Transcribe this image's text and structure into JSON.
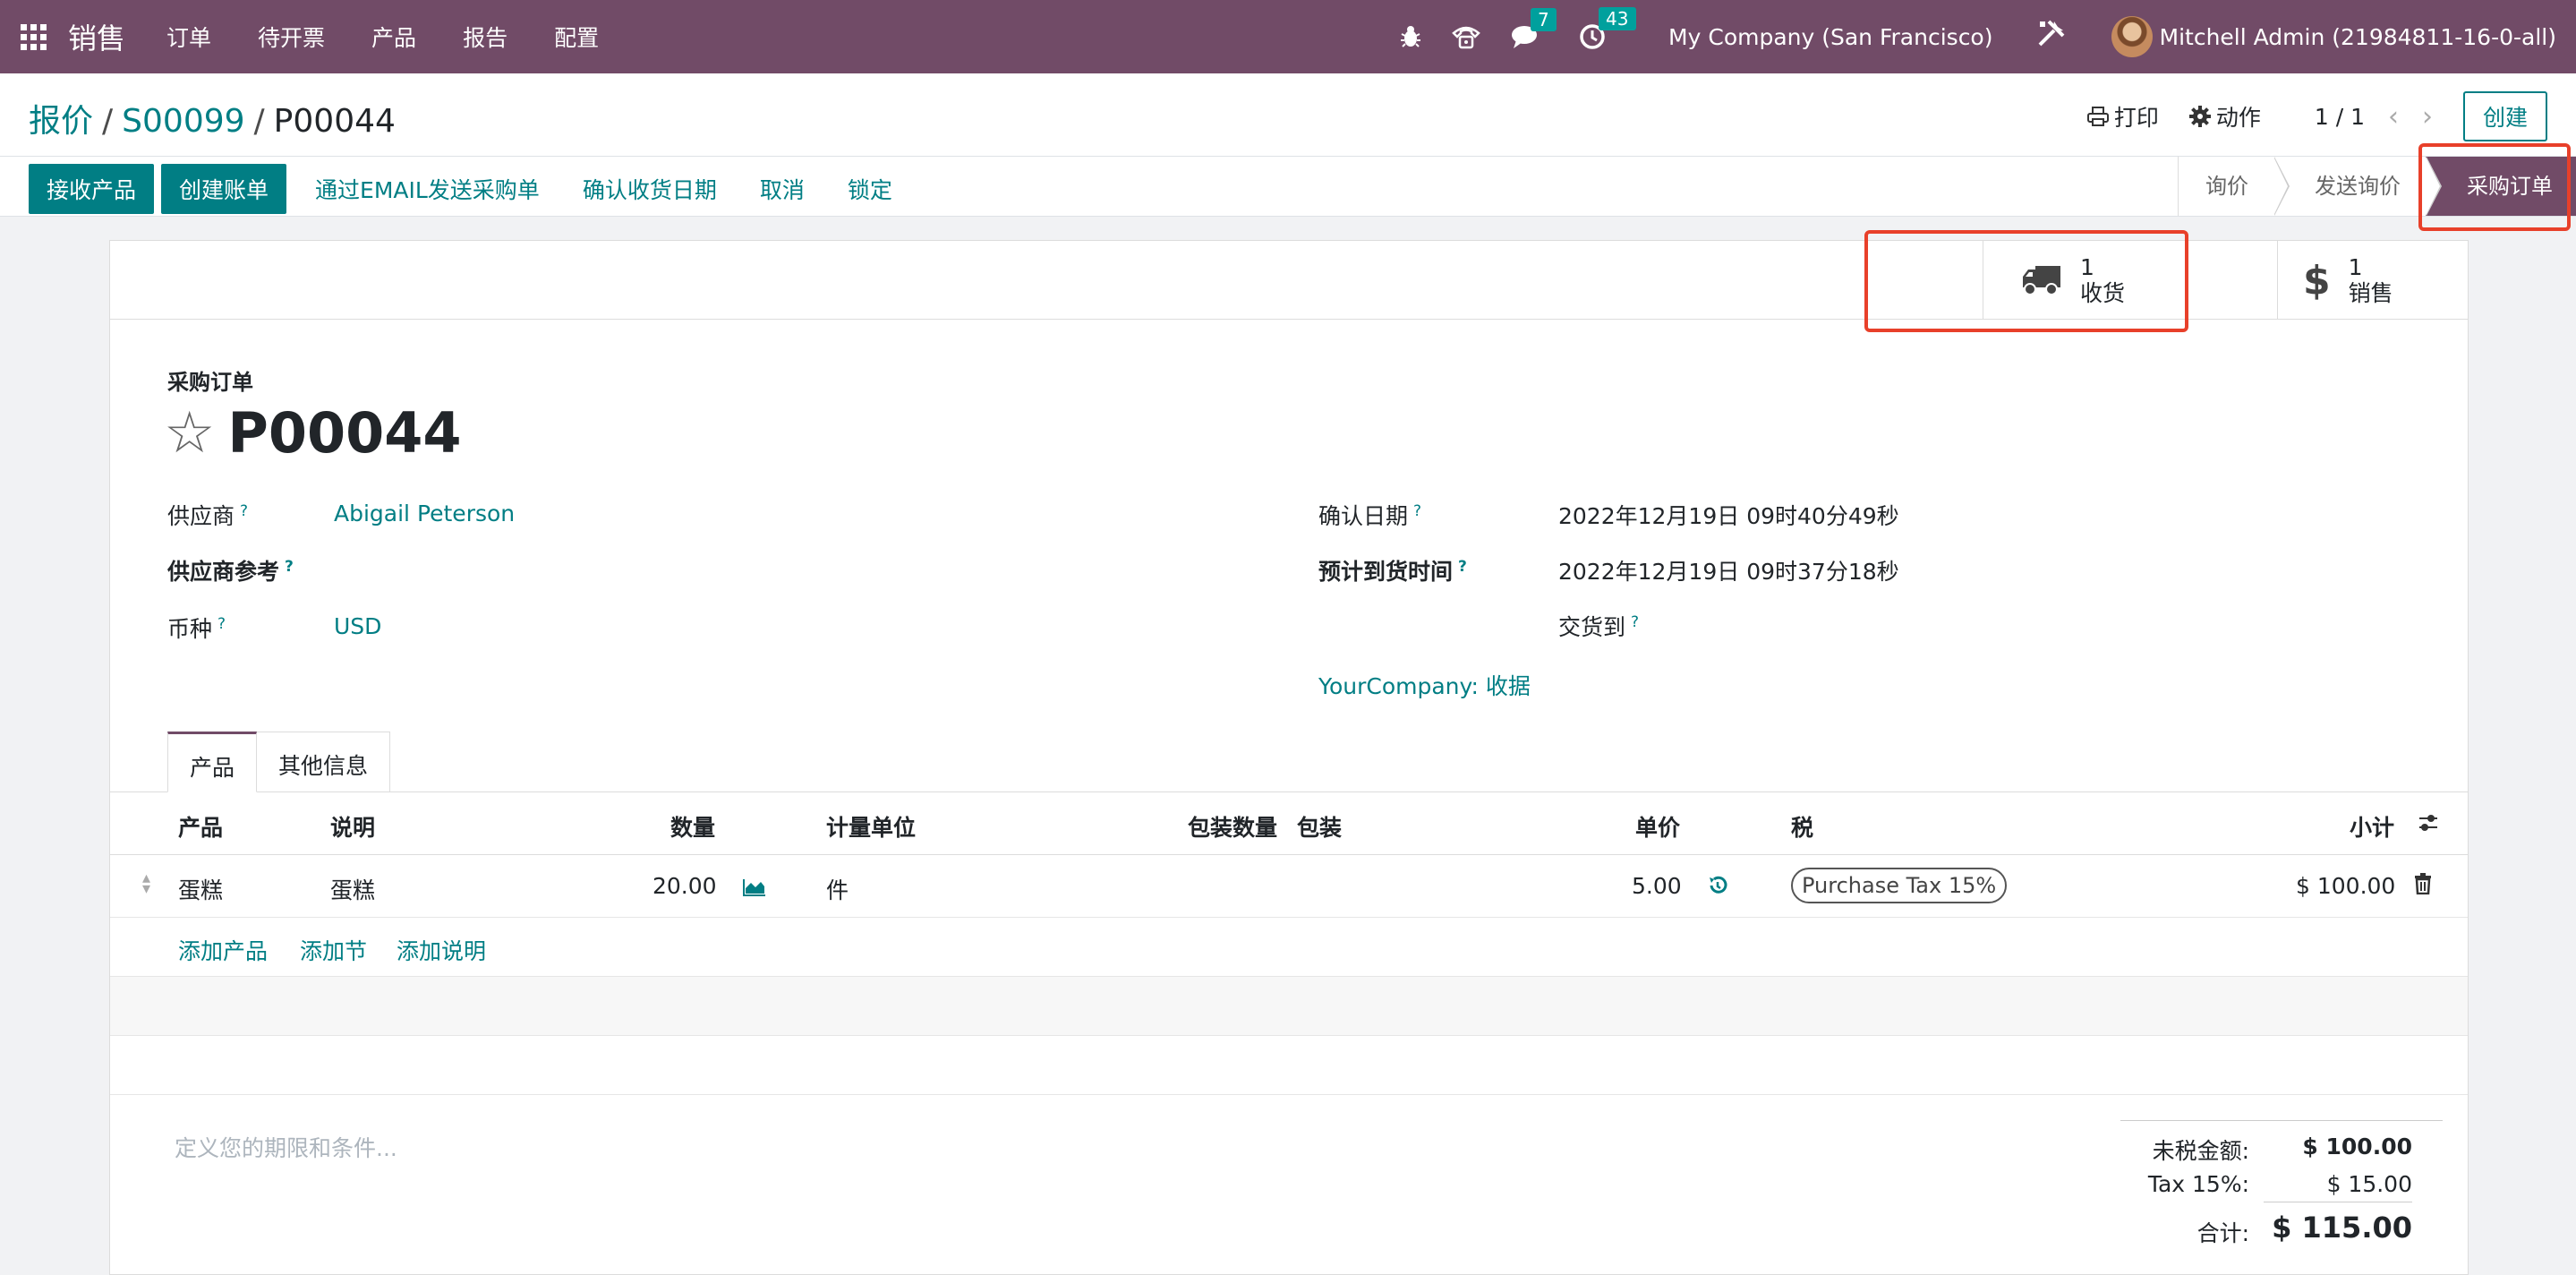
{
  "topnav": {
    "app_name": "销售",
    "menu": [
      "订单",
      "待开票",
      "产品",
      "报告",
      "配置"
    ],
    "messages_count": "7",
    "activities_count": "43",
    "company": "My Company (San Francisco)",
    "user": "Mitchell Admin (21984811-16-0-all)"
  },
  "breadcrumb": {
    "items": [
      "报价",
      "S00099"
    ],
    "current": "P00044",
    "separator": "/"
  },
  "control": {
    "print_label": "打印",
    "action_label": "动作",
    "pager": "1 / 1",
    "create_label": "创建"
  },
  "statusbar": {
    "buttons_primary": [
      "接收产品",
      "创建账单"
    ],
    "buttons_link": [
      "通过EMAIL发送采购单",
      "确认收货日期",
      "取消",
      "锁定"
    ],
    "stages": [
      "询价",
      "发送询价",
      "采购订单"
    ],
    "active_stage": "采购订单"
  },
  "smart_buttons": {
    "receipts": {
      "count": "1",
      "label": "收货",
      "icon": "truck-icon"
    },
    "sales": {
      "count": "1",
      "label": "销售",
      "icon": "dollar-icon"
    }
  },
  "form": {
    "doc_type": "采购订单",
    "name": "P00044",
    "vendor_label": "供应商",
    "vendor": "Abigail Peterson",
    "vendor_ref_label": "供应商参考",
    "currency_label": "币种",
    "currency": "USD",
    "confirm_date_label": "确认日期",
    "confirm_date": "2022年12月19日 09时40分49秒",
    "expected_arrival_label": "预计到货时间",
    "expected_arrival": "2022年12月19日 09时37分18秒",
    "deliver_to_label": "交货到",
    "deliver_to": "YourCompany: 收据",
    "help_marker": "?"
  },
  "tabs": [
    "产品",
    "其他信息"
  ],
  "table": {
    "headers": {
      "product": "产品",
      "description": "说明",
      "quantity": "数量",
      "uom": "计量单位",
      "packaging_qty": "包装数量",
      "packaging": "包装",
      "price_unit": "单价",
      "taxes": "税",
      "subtotal": "小计"
    },
    "rows": [
      {
        "product": "蛋糕",
        "description": "蛋糕",
        "quantity": "20.00",
        "uom": "件",
        "price_unit": "5.00",
        "tax": "Purchase Tax 15%",
        "subtotal": "$ 100.00"
      }
    ],
    "add_links": [
      "添加产品",
      "添加节",
      "添加说明"
    ]
  },
  "footer": {
    "terms_placeholder": "定义您的期限和条件...",
    "untaxed_label": "未税金额:",
    "untaxed_value": "$ 100.00",
    "tax_label": "Tax 15%:",
    "tax_value": "$ 15.00",
    "total_label": "合计:",
    "total_value": "$ 115.00"
  },
  "colors": {
    "brand": "#714b67",
    "accent": "#017e84",
    "highlight": "#e8402a"
  }
}
